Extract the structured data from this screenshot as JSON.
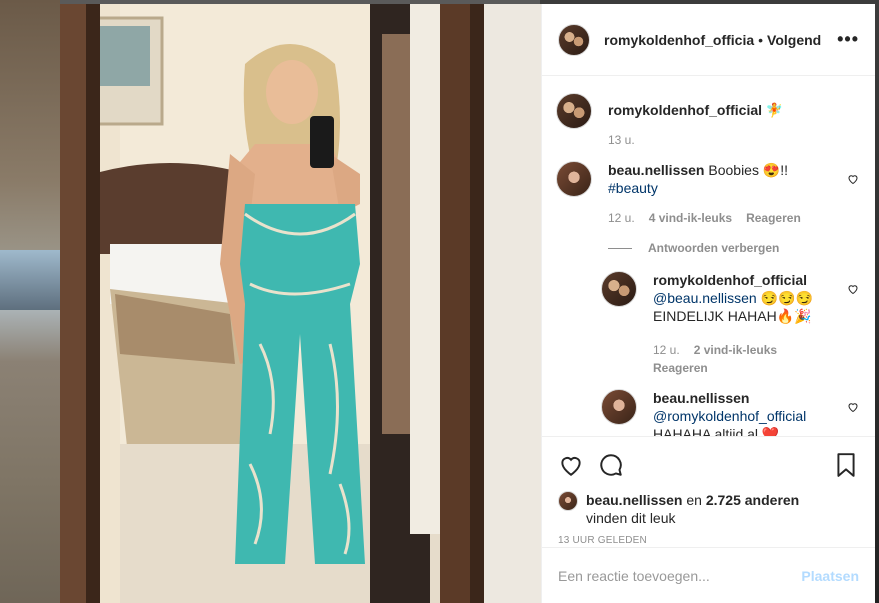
{
  "post": {
    "author": "romykoldenhof_officia",
    "follow_separator": "•",
    "follow_label": "Volgend",
    "more_label": "•••"
  },
  "caption": {
    "user": "romykoldenhof_official",
    "emoji": "🧚",
    "time": "13 u."
  },
  "comments": [
    {
      "user": "beau.nellissen",
      "text": "Boobies 😍!!",
      "hashtag": "#beauty",
      "time": "12 u.",
      "likes": "4 vind-ik-leuks",
      "reply_label": "Reageren",
      "toggle_label": "Antwoorden verbergen"
    }
  ],
  "replies": [
    {
      "user": "romykoldenhof_official",
      "mention": "@beau.nellissen",
      "text1": "😏😏😏",
      "text2": "EINDELIJK HAHAH🔥🎉",
      "time": "12 u.",
      "likes": "2 vind-ik-leuks",
      "reply_label": "Reageren"
    },
    {
      "user": "beau.nellissen",
      "mention": "@romykoldenhof_official",
      "text2": "HAHAHA altijd al ❤️"
    }
  ],
  "likes": {
    "user": "beau.nellissen",
    "connector": "en",
    "count": "2.725 anderen",
    "suffix": "vinden dit leuk"
  },
  "timestamp": "13 UUR GELEDEN",
  "add_comment": {
    "placeholder": "Een reactie toevoegen...",
    "post_label": "Plaatsen"
  },
  "colors": {
    "link": "#003569",
    "meta": "#8e8e8e",
    "post_disabled": "#b3dbff",
    "jumpsuit": "#3fb8b0"
  }
}
